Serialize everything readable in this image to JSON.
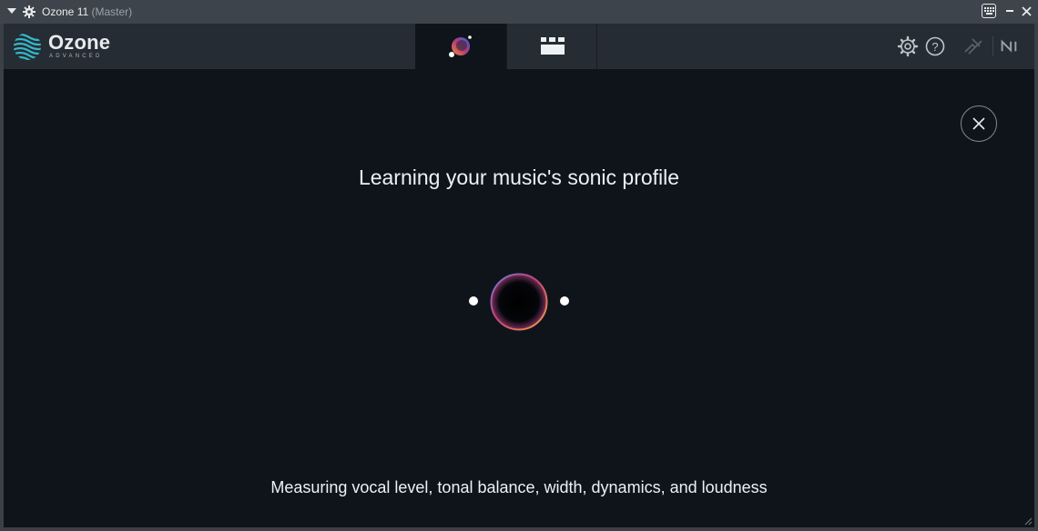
{
  "titlebar": {
    "title": "Ozone 11",
    "title_suffix": "(Master)"
  },
  "header": {
    "brand": "Ozone",
    "edition": "ADVANCED",
    "tabs": [
      {
        "id": "assistant",
        "icon": "assistant-orb-icon",
        "active": true
      },
      {
        "id": "modules",
        "icon": "modules-grid-icon",
        "active": false
      }
    ],
    "icons": [
      "gear-icon",
      "help-icon",
      "link-icon",
      "native-instruments-logo"
    ]
  },
  "main": {
    "heading": "Learning your music's sonic profile",
    "status": "Measuring vocal level, tonal balance, width, dynamics, and loudness"
  },
  "colors": {
    "background": "#0f141b",
    "header": "#262c33",
    "titlebar": "#3d444b",
    "text": "#eef1f3"
  }
}
